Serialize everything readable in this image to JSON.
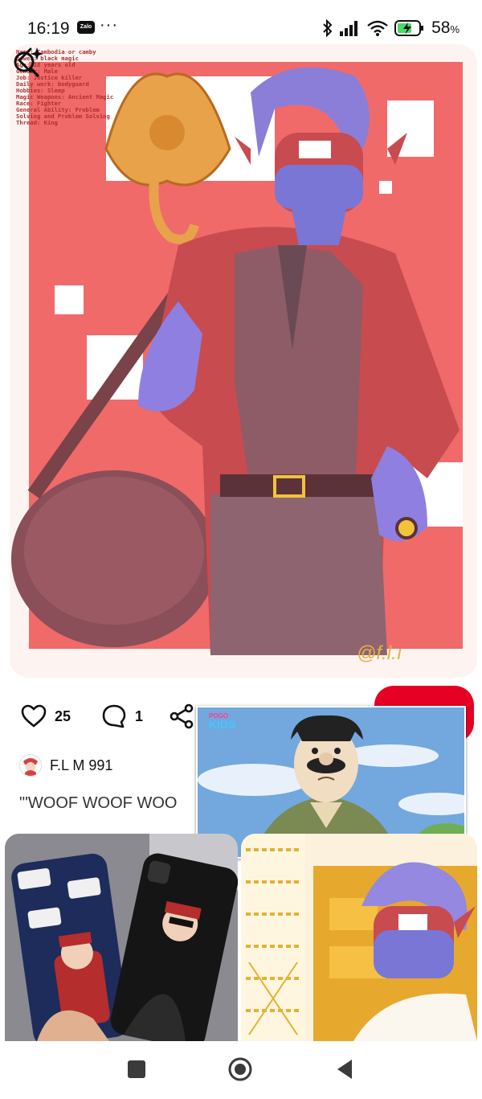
{
  "status_bar": {
    "time": "16:19",
    "notification_app": "Zalo",
    "more_indicator": "···",
    "battery_percent": "58",
    "battery_unit": "%"
  },
  "pin": {
    "character_sheet": [
      "Name: Cambodia or camby",
      "power: black magic",
      "Age: 18 years old",
      "Gender: Male",
      "Job: Justice killer",
      "Daily work: bodyguard",
      "Hobbies: Sleep",
      "Magic Weapons: Ancient Magic",
      "Race: Fighter",
      "General Ability: Problem",
      "Solving and Problem Solving",
      "Thread: King"
    ],
    "watermark": "@f.l.ı",
    "likes": "25",
    "comments": "1",
    "author": "F.L M 991",
    "description": "\"'WOOF WOOF WOO"
  },
  "pip_video": {
    "channel_logo_top": "POGO",
    "channel_logo_bottom": "KIDS"
  },
  "icons": {
    "back": "chevron-left-icon",
    "visual_search": "lens-search-icon",
    "like": "heart-icon",
    "comment": "comment-bubble-icon",
    "share": "share-icon",
    "nav_recents": "square-icon",
    "nav_home": "circle-icon",
    "nav_back": "triangle-back-icon"
  },
  "colors": {
    "save_button": "#e60023",
    "flag_red": "#f06a6a"
  }
}
